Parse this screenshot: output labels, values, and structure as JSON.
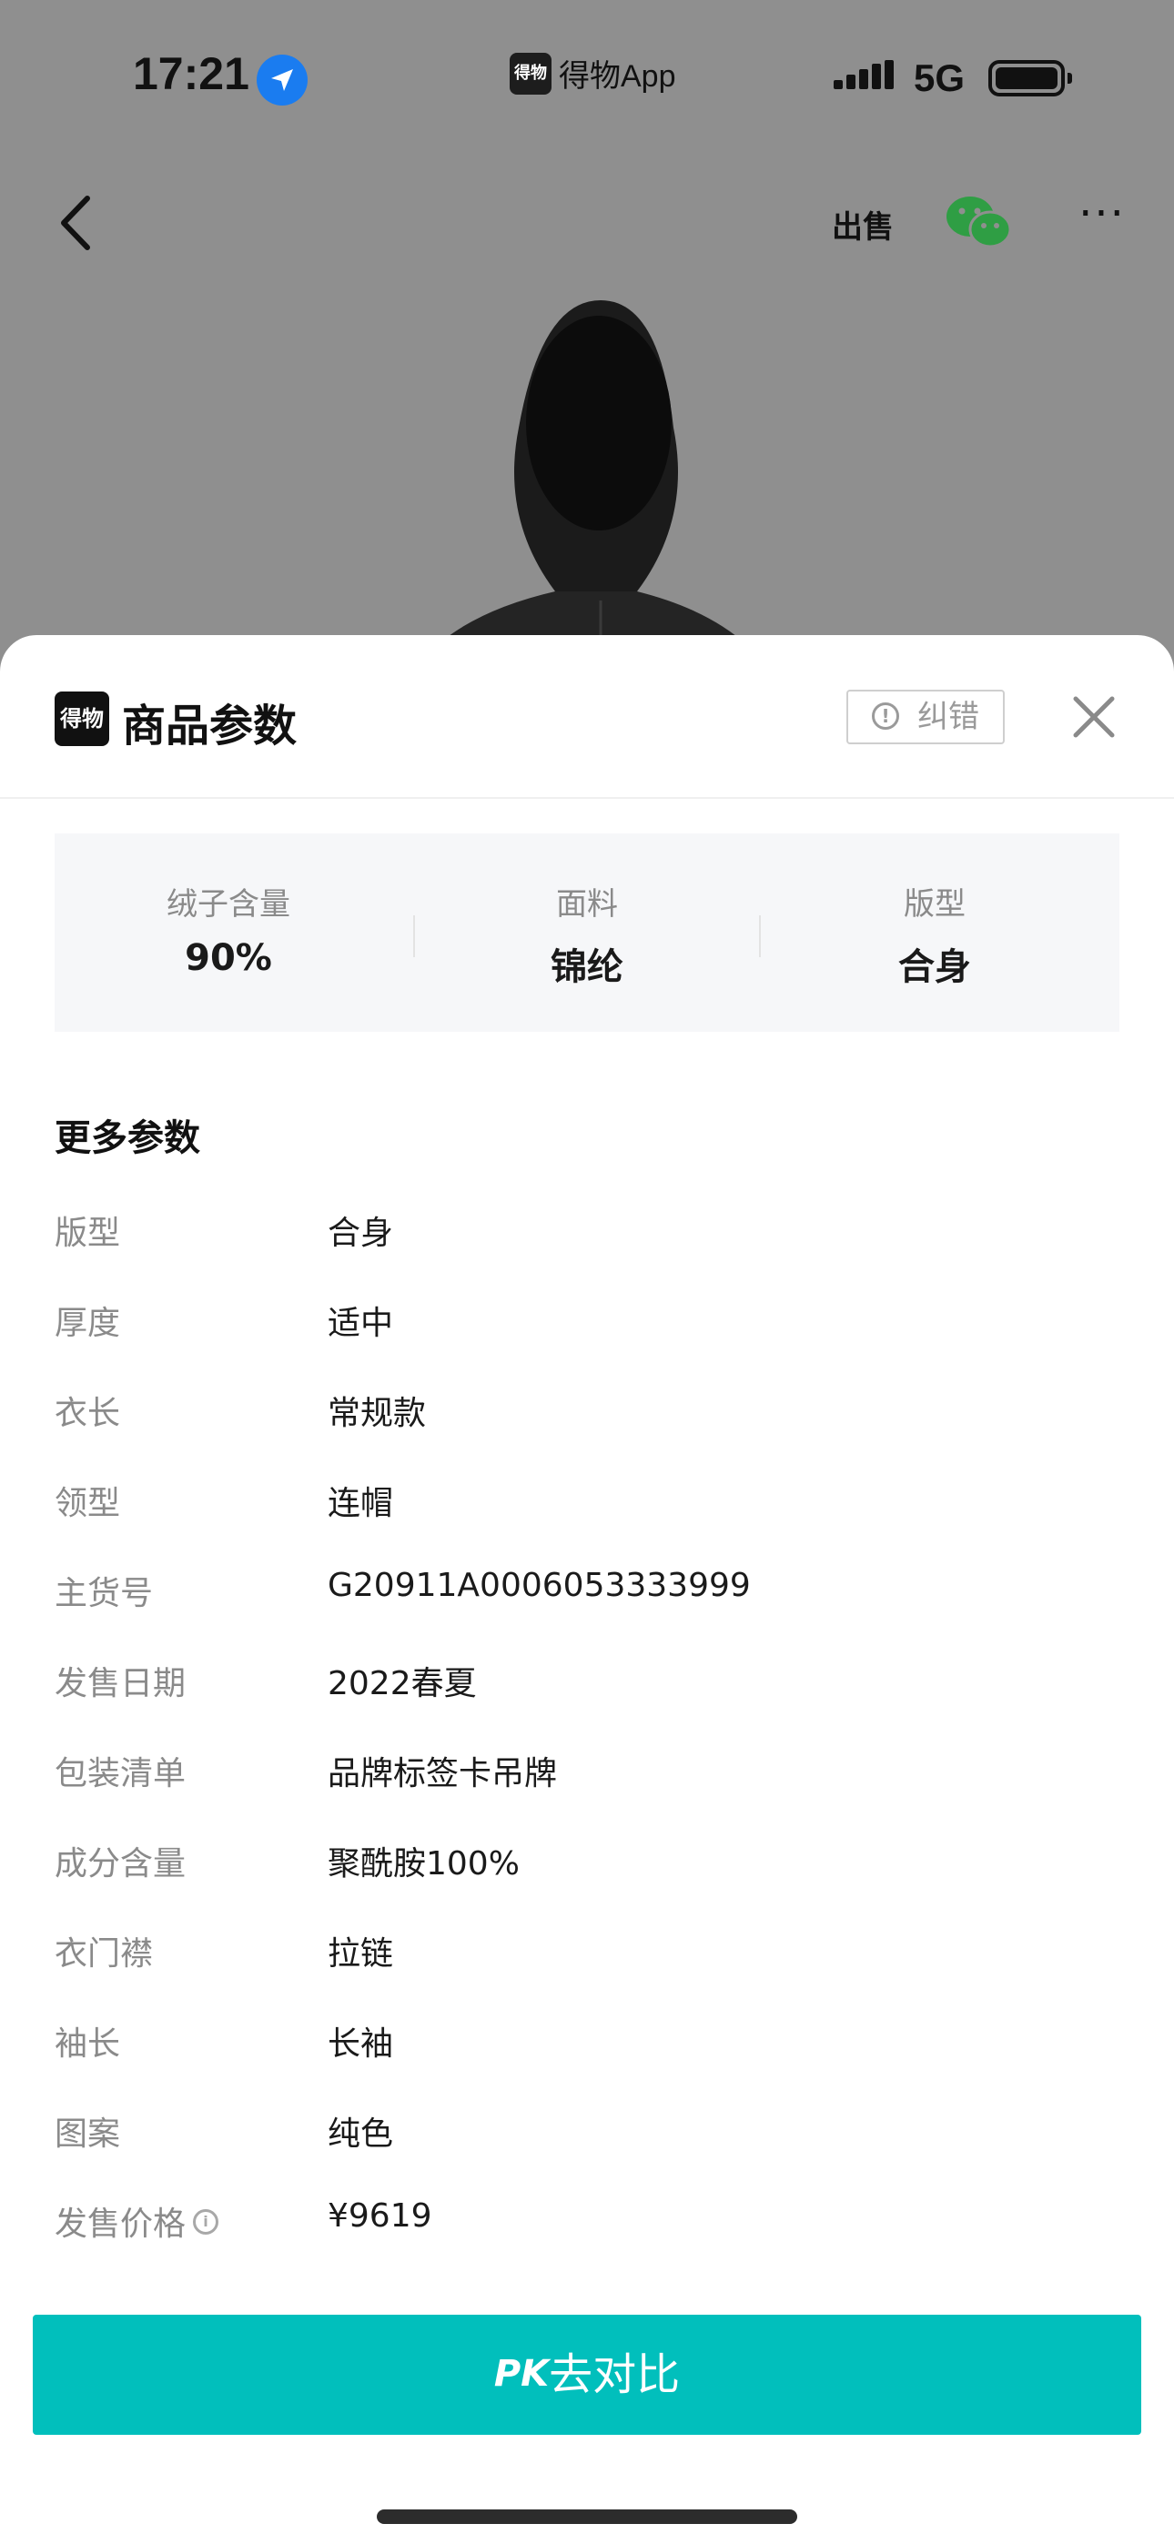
{
  "status_bar": {
    "time": "17:21",
    "app_badge": "得物",
    "app_name": "得物App",
    "network": "5G"
  },
  "nav": {
    "sell_label": "出售"
  },
  "sheet": {
    "logo_text": "得物",
    "title": "商品参数",
    "report_label": "纠错",
    "summary": [
      {
        "label": "绒子含量",
        "value": "90%"
      },
      {
        "label": "面料",
        "value": "锦纶"
      },
      {
        "label": "版型",
        "value": "合身"
      }
    ],
    "more_title": "更多参数",
    "params": [
      {
        "label": "版型",
        "value": "合身"
      },
      {
        "label": "厚度",
        "value": "适中"
      },
      {
        "label": "衣长",
        "value": "常规款"
      },
      {
        "label": "领型",
        "value": "连帽"
      },
      {
        "label": "主货号",
        "value": "G20911A0006053333999"
      },
      {
        "label": "发售日期",
        "value": "2022春夏"
      },
      {
        "label": "包装清单",
        "value": "品牌标签卡吊牌"
      },
      {
        "label": "成分含量",
        "value": "聚酰胺100%"
      },
      {
        "label": "衣门襟",
        "value": "拉链"
      },
      {
        "label": "袖长",
        "value": "长袖"
      },
      {
        "label": "图案",
        "value": "纯色"
      },
      {
        "label": "发售价格",
        "value": "¥9619"
      }
    ],
    "cta_mark": "PK",
    "cta_label": "去对比"
  },
  "colors": {
    "accent": "#01bfbc",
    "backdrop": "#8f8f8f",
    "wechat_green": "#2f9e44",
    "location_blue": "#1a7cf0"
  }
}
